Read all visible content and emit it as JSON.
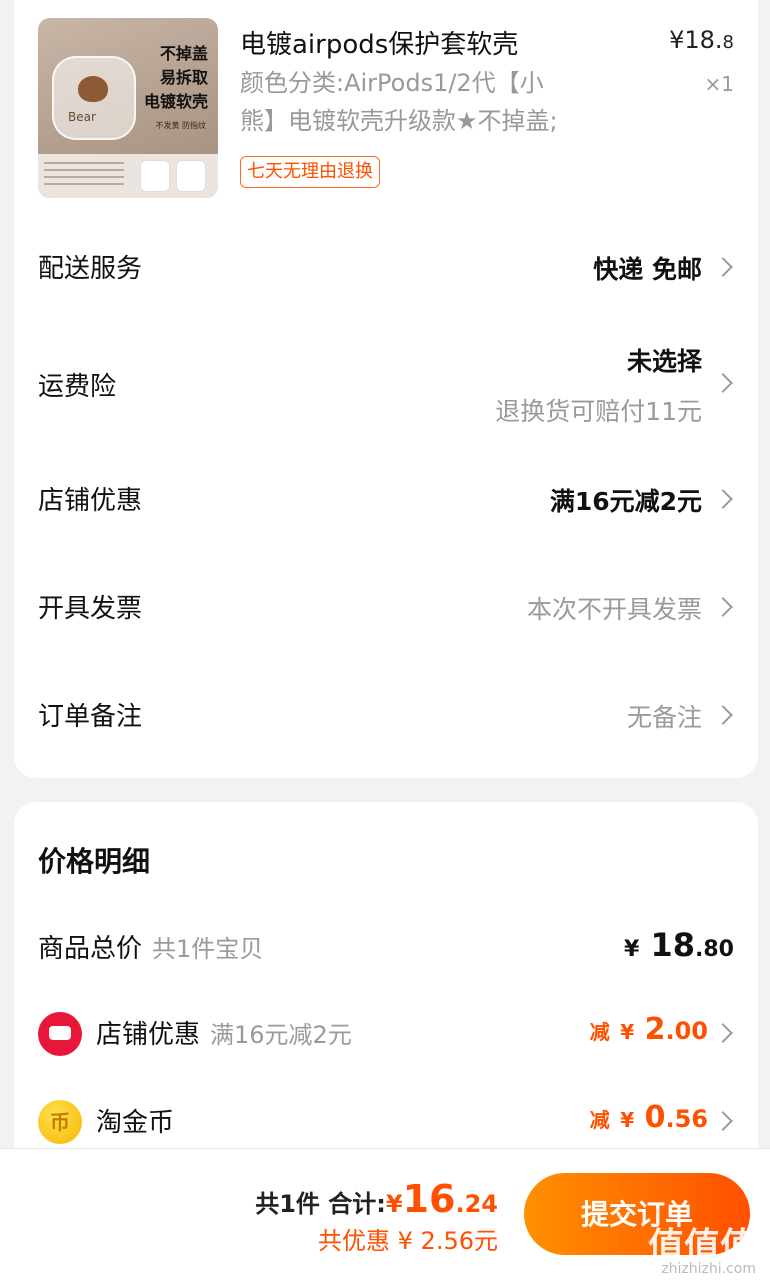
{
  "product": {
    "image_text": {
      "line1": "不掉盖",
      "line2": "易拆取",
      "line3": "电镀软壳",
      "small": "不发黄  防指纹",
      "case_text": "Bear"
    },
    "title": "电镀airpods保护套软壳",
    "price_main": "¥18.",
    "price_cents": "8",
    "quantity": "×1",
    "spec_line1": "颜色分类:AirPods1/2代【小",
    "spec_line2": "熊】电镀软壳升级款★不掉盖;",
    "badge": "七天无理由退换"
  },
  "rows": {
    "delivery": {
      "label": "配送服务",
      "value": "快递 免邮"
    },
    "insurance": {
      "label": "运费险",
      "value": "未选择",
      "sub": "退换货可赔付11元"
    },
    "shop_promo": {
      "label": "店铺优惠",
      "value": "满16元减2元"
    },
    "invoice": {
      "label": "开具发票",
      "value": "本次不开具发票"
    },
    "remark": {
      "label": "订单备注",
      "value": "无备注"
    }
  },
  "price_detail": {
    "title": "价格明细",
    "total": {
      "label": "商品总价",
      "sub": "共1件宝贝",
      "yen": "¥",
      "int": "18",
      "dec": ".80"
    },
    "shop_discount": {
      "label": "店铺优惠",
      "sub": "满16元减2元",
      "pre": "减",
      "yen": "¥",
      "int": "2",
      "dec": ".00"
    },
    "coins": {
      "label": "淘金币",
      "pre": "减",
      "yen": "¥",
      "int": "0",
      "dec": ".56",
      "icon_glyph": "币"
    }
  },
  "footer": {
    "count": "共1件",
    "total_label": "合计:",
    "yen": "¥",
    "total_int": "16",
    "total_dec": ".24",
    "savings": "共优惠 ¥ 2.56元",
    "submit": "提交订单",
    "watermark": "值值值",
    "watermark_url": "zhizhizhi.com"
  },
  "colors": {
    "accent": "#ff5000",
    "gray_text": "#9a9a9a",
    "shop_icon": "#e8173a",
    "coin_icon": "#f7b500"
  }
}
